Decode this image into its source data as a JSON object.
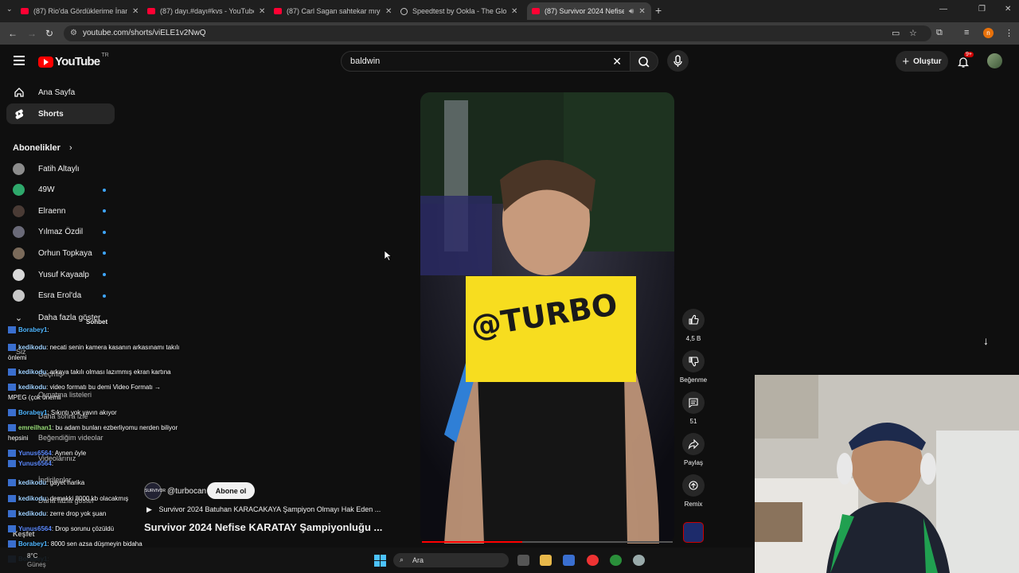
{
  "browser": {
    "tabs": [
      {
        "title": "(87) Rio'da Gördüklerime İnanam",
        "active": false
      },
      {
        "title": "(87) dayı.#dayı#kvs - YouTube",
        "active": false
      },
      {
        "title": "(87) Carl Sagan sahtekar mıydı?",
        "active": false
      },
      {
        "title": "Speedtest by Ookla - The Global",
        "active": false
      },
      {
        "title": "(87) Survivor 2024 Nefise K",
        "active": true
      }
    ],
    "url": "youtube.com/shorts/viELE1v2NwQ",
    "profile_initial": "n"
  },
  "masthead": {
    "logo_text": "YouTube",
    "country_code": "TR",
    "search_value": "baldwin",
    "create_label": "Oluştur",
    "notif_badge": "9+"
  },
  "sidebar": {
    "main": [
      {
        "label": "Ana Sayfa",
        "icon": "home-icon",
        "active": false
      },
      {
        "label": "Shorts",
        "icon": "shorts-icon",
        "active": true
      }
    ],
    "subs_heading": "Abonelikler",
    "subscriptions": [
      {
        "name": "Fatih Altaylı",
        "dot": false,
        "color": "#8c8c8c"
      },
      {
        "name": "49W",
        "dot": true,
        "color": "#2ea86b"
      },
      {
        "name": "Elraenn",
        "dot": true,
        "color": "#4a3b35"
      },
      {
        "name": "Yılmaz Özdil",
        "dot": true,
        "color": "#6a6a78"
      },
      {
        "name": "Orhun Topkaya",
        "dot": true,
        "color": "#7a6a5a"
      },
      {
        "name": "Yusuf Kayaalp",
        "dot": true,
        "color": "#d8d8d8"
      },
      {
        "name": "Esra Erol'da",
        "dot": true,
        "color": "#c8c8c8"
      }
    ],
    "show_more": "Daha fazla göster",
    "ghost_items": [
      "Siz",
      "Geçmiş",
      "Oynatma listeleri",
      "Daha sonra izle",
      "Beğendiğim videolar",
      "Videolarınız",
      "İndirilenler",
      "Daha fazla göster",
      "Keşfet"
    ]
  },
  "chat": {
    "header": "Sohbet",
    "messages": [
      {
        "user": "Borabey1",
        "text": ":"
      },
      {
        "user": "kedikodu",
        "text": ": necati senin kamera kasanın arkasınamı takılı"
      },
      {
        "user": "",
        "text": "önlemi"
      },
      {
        "user": "kedikodu",
        "text": ": arkaya takılı olması lazımmış ekran kartına"
      },
      {
        "user": "kedikodu",
        "text": ": video formatı bu demi Video Formatı →"
      },
      {
        "user": "",
        "text": "MPEG (çok önemli"
      },
      {
        "user": "Borabey1",
        "text": ": Sıkıntı yok yavın akıyor"
      },
      {
        "user": "emreilhan1",
        "text": ": bu adam bunları ezberliyomu nerden biliyor"
      },
      {
        "user": "",
        "text": "hepsini"
      },
      {
        "user": "Yunus6564",
        "text": ": Aynen öyle"
      },
      {
        "user": "Yunus6564",
        "text": ":"
      },
      {
        "user": "kedikodu",
        "text": ": gayet harika"
      },
      {
        "user": "kedikodu",
        "text": ": demekki 8000 kb olacakmış"
      },
      {
        "user": "kedikodu",
        "text": ": zerre drop yok şuan"
      },
      {
        "user": "Yunus6564",
        "text": ": Drop sorunu çözüldü"
      },
      {
        "user": "Borabey1",
        "text": ": 8000 sen azsa düşmeyin bidaha"
      },
      {
        "user": "Borabey1",
        "text": ":"
      }
    ]
  },
  "short": {
    "overlay_text": "@TURBO",
    "channel": "@turbocan",
    "channel_avatar_text": "SURVIVOR",
    "subscribe_label": "Abone ol",
    "related": "Survivor 2024 Batuhan KARACAKAYA Şampiyon Olmayı Hak Eden ...",
    "title": "Survivor 2024 Nefise KARATAY Şampiyonluğu ...",
    "progress": 0.4,
    "actions": [
      {
        "icon": "like-icon",
        "label": "4,5 B"
      },
      {
        "icon": "dislike-icon",
        "label": "Beğenme"
      },
      {
        "icon": "comment-icon",
        "label": "51"
      },
      {
        "icon": "share-icon",
        "label": "Paylaş"
      },
      {
        "icon": "remix-icon",
        "label": "Remix"
      }
    ]
  },
  "taskbar": {
    "search_label": "Ara",
    "weather": "8°C",
    "weather_sub": "Güneş"
  }
}
